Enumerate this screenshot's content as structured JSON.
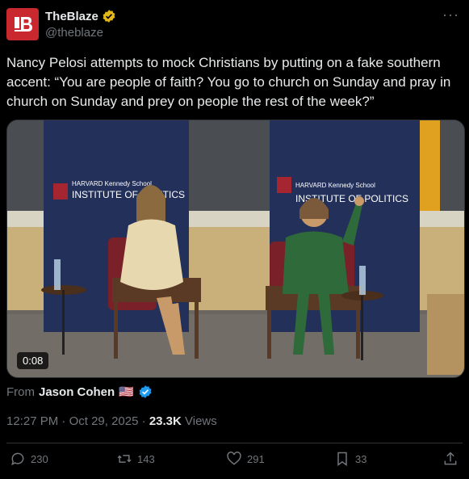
{
  "account": {
    "name": "TheBlaze",
    "handle": "@theblaze",
    "more_label": "···"
  },
  "tweet": {
    "text": "Nancy Pelosi attempts to mock Christians by putting on a fake southern accent: “You are people of faith? You go to church on Sunday and pray in church on Sunday and prey on people the rest of the week?”"
  },
  "media": {
    "type": "video",
    "duration": "0:08",
    "banner_top": "HARVARD Kennedy School",
    "banner_bottom": "INSTITUTE OF POLITICS"
  },
  "attribution": {
    "prefix": "From",
    "author": "Jason Cohen",
    "flag": "🇺🇸"
  },
  "meta": {
    "time": "12:27 PM",
    "date": "Oct 29, 2025",
    "separator": "·",
    "views_count": "23.3K",
    "views_label": "Views"
  },
  "actions": {
    "replies": "230",
    "reposts": "143",
    "likes": "291",
    "bookmarks": "33"
  },
  "colors": {
    "background": "#000000",
    "text": "#e7e9ea",
    "muted": "#71767b",
    "brand_red": "#c8282e",
    "verified_gold": "#e2b719",
    "verified_blue": "#1d9bf0"
  }
}
